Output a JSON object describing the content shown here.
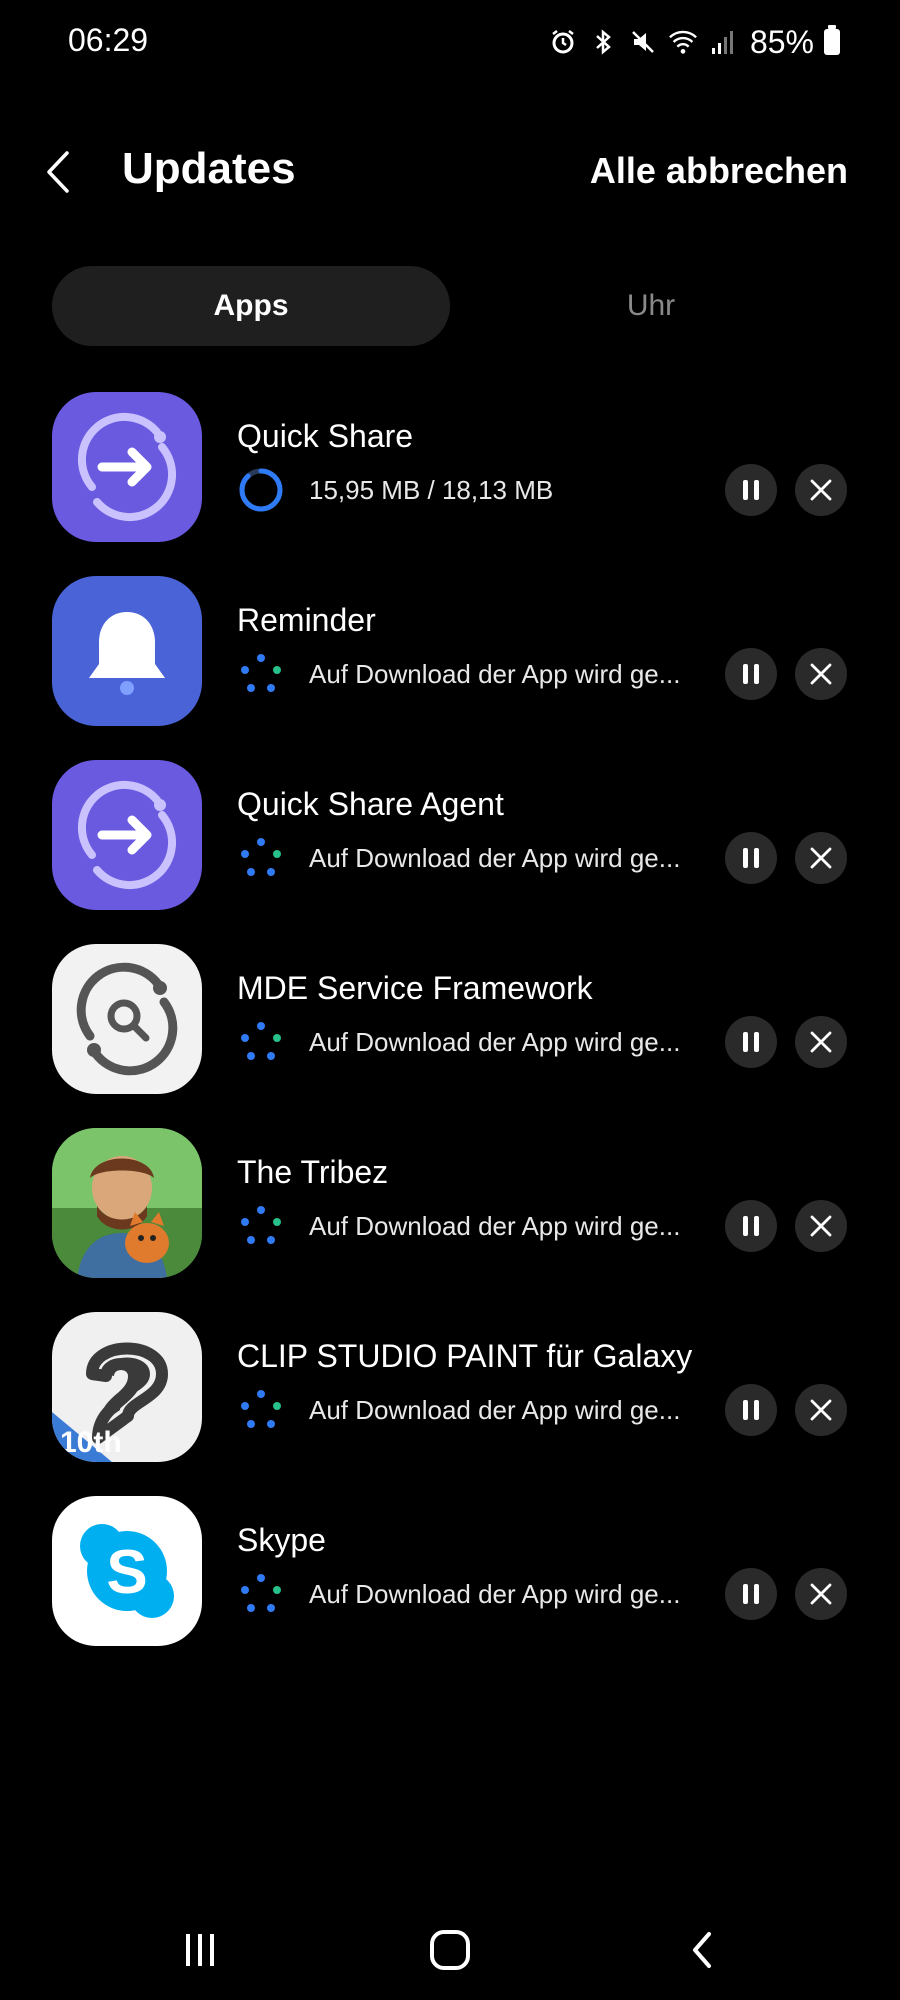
{
  "status_bar": {
    "time": "06:29",
    "battery": "85%",
    "icons": [
      "alarm-icon",
      "bluetooth-icon",
      "mute-icon",
      "wifi-icon",
      "signal-icon",
      "battery-icon"
    ]
  },
  "header": {
    "back_icon": "chevron-left-icon",
    "title": "Updates",
    "cancel_all": "Alle abbrechen"
  },
  "tabs": [
    {
      "label": "Apps",
      "selected": true
    },
    {
      "label": "Uhr",
      "selected": false
    }
  ],
  "apps": [
    {
      "name": "Quick Share",
      "status": "15,95 MB / 18,13 MB",
      "progress": 0.88,
      "icon": "quick-share-icon"
    },
    {
      "name": "Reminder",
      "status": "Auf Download der App wird ge...",
      "icon": "bell-icon"
    },
    {
      "name": "Quick Share Agent",
      "status": "Auf Download der App wird ge...",
      "icon": "quick-share-icon"
    },
    {
      "name": "MDE Service Framework",
      "status": "Auf Download der App wird ge...",
      "icon": "mde-search-icon"
    },
    {
      "name": "The Tribez",
      "status": "Auf Download der App wird ge...",
      "icon": "tribez-game-icon"
    },
    {
      "name": "CLIP STUDIO PAINT für Galaxy",
      "status": "Auf Download der App wird ge...",
      "icon": "clip-studio-icon",
      "icon_badge": "10th"
    },
    {
      "name": "Skype",
      "status": "Auf Download der App wird ge...",
      "icon": "skype-icon"
    }
  ],
  "row_controls": {
    "pause_icon": "pause-icon",
    "cancel_icon": "close-icon"
  },
  "colors": {
    "background": "#000000",
    "tab_selected": "#1f1f1f",
    "accent_blue": "#2f7bf5",
    "accent_green": "#27c08a",
    "quick_share_purple": "#6a5ae0",
    "reminder_blue": "#4a64d8",
    "skype_blue": "#00aff0"
  },
  "nav_bar": [
    "recents-icon",
    "home-icon",
    "back-icon"
  ]
}
